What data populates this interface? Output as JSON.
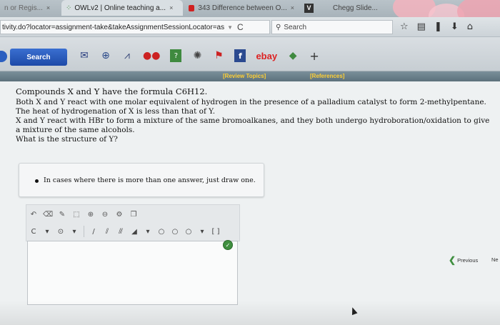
{
  "colors": {
    "accent_blue": "#1d4aa8",
    "ref_link": "#ffcf33",
    "check_green": "#3f8f3f"
  },
  "tabs": [
    {
      "label": "n or Regis...",
      "close": "×"
    },
    {
      "label": "OWLv2 | Online teaching a...",
      "close": "×"
    },
    {
      "label": "343 Difference between O...",
      "close": "×"
    },
    {
      "label": "V"
    },
    {
      "label": "Chegg Slide..."
    }
  ],
  "address": {
    "url": "tivity.do?locator=assignment-take&takeAssignmentSessionLocator=as",
    "reload": "C",
    "search_placeholder": "Search"
  },
  "toolbar": {
    "search_label": "Search",
    "ebay_label": "ebay",
    "add_label": "+"
  },
  "page": {
    "review_topics": "[Review Topics]",
    "references": "[References]",
    "question_lines": [
      "Compounds X and Y have the formula C6H12.",
      "Both X and Y react with one molar equivalent of hydrogen in the presence of a palladium catalyst to form 2-methylpentane.",
      "The heat of hydrogenation of X is less than that of Y.",
      "X and Y react with HBr to form a mixture of the same bromoalkanes, and they both undergo hydroboration/oxidation to give a mixture of the same alcohols.",
      "What is the structure of Y?"
    ],
    "hint": "In cases where there is more than one answer, just draw one.",
    "previous_label": "Previous",
    "next_label": "Ne"
  }
}
